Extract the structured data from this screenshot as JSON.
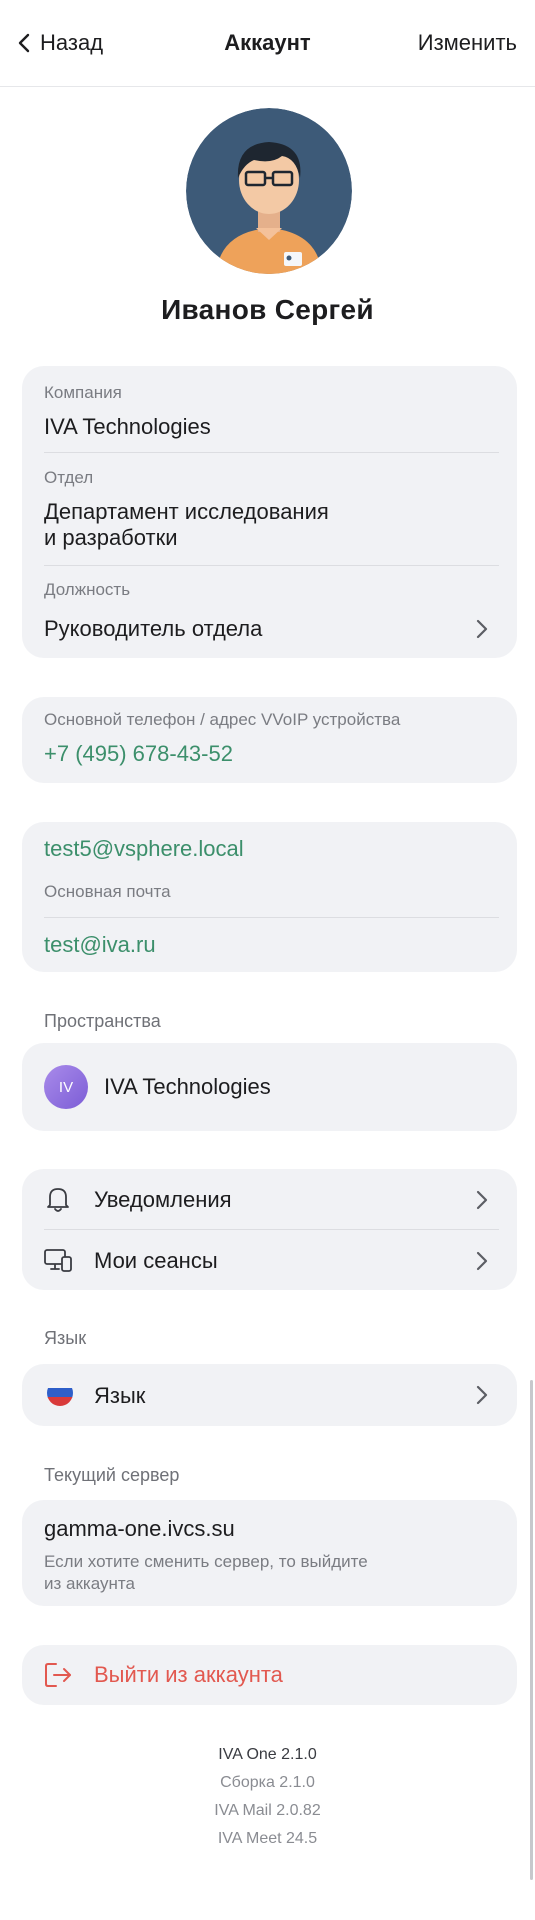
{
  "header": {
    "back_label": "Назад",
    "title": "Аккаунт",
    "edit_label": "Изменить"
  },
  "profile": {
    "name": "Иванов Сергей"
  },
  "org": {
    "company_label": "Компания",
    "company_value": "IVA Technologies",
    "department_label": "Отдел",
    "department_line1": "Департамент исследования",
    "department_line2": "и разработки",
    "position_label": "Должность",
    "position_value": "Руководитель отдела"
  },
  "phone": {
    "label": "Основной телефон / адрес VVoIP устройства",
    "value": "+7 (495) 678-43-52"
  },
  "email": {
    "secondary": "test5@vsphere.local",
    "primary_label": "Основная почта",
    "primary_value": "test@iva.ru"
  },
  "spaces": {
    "section_title": "Пространства",
    "badge": "IV",
    "name": "IVA Technologies"
  },
  "settings": {
    "notifications": "Уведомления",
    "sessions": "Мои сеансы"
  },
  "language": {
    "section_title": "Язык",
    "label": "Язык"
  },
  "server": {
    "section_title": "Текущий сервер",
    "value": "gamma-one.ivcs.su",
    "hint_line1": "Если хотите сменить сервер, то выйдите",
    "hint_line2": "из аккаунта"
  },
  "logout": {
    "label": "Выйти из аккаунта"
  },
  "footer": {
    "line1": "IVA One 2.1.0",
    "line2": "Сборка 2.1.0",
    "line3": "IVA Mail 2.0.82",
    "line4": "IVA Meet 24.5"
  },
  "colors": {
    "accent_green": "#3c8f6b",
    "danger": "#e2584f",
    "card_bg": "#f1f2f5"
  }
}
